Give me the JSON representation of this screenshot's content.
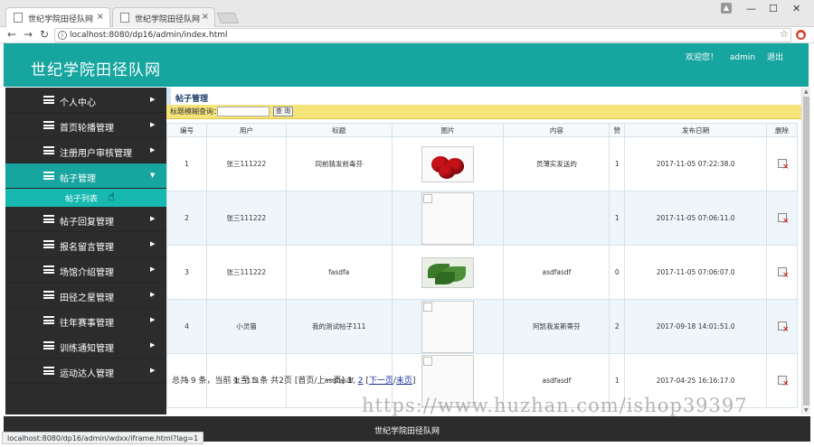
{
  "browser": {
    "tabs": [
      {
        "title": "世纪学院田径队网",
        "active": true
      },
      {
        "title": "世纪学院田径队网",
        "active": false
      }
    ],
    "url": "localhost:8080/dp16/admin/index.html",
    "status_url": "localhost:8080/dp16/admin/wdxx/iframe.html?lag=1"
  },
  "header": {
    "site_title": "世纪学院田径队网",
    "welcome": "欢迎您！",
    "username": "admin",
    "logout": "退出"
  },
  "sidebar": {
    "items": [
      {
        "label": "个人中心"
      },
      {
        "label": "首页轮播管理"
      },
      {
        "label": "注册用户审核管理"
      },
      {
        "label": "帖子管理",
        "open": true
      },
      {
        "label": "帖子回复管理"
      },
      {
        "label": "报名留言管理"
      },
      {
        "label": "场馆介绍管理"
      },
      {
        "label": "田径之星管理"
      },
      {
        "label": "往年赛事管理"
      },
      {
        "label": "训练通知管理"
      },
      {
        "label": "运动达人管理"
      }
    ],
    "sub_item": "帖子列表"
  },
  "main": {
    "breadcrumb": "帖子管理",
    "search": {
      "label": "标题模糊查询：",
      "button": "查 询",
      "value": ""
    },
    "table": {
      "headers": [
        "编号",
        "用户",
        "标题",
        "图片",
        "内容",
        "赞",
        "发布日期",
        "删除"
      ],
      "rows": [
        {
          "id": "1",
          "user": "张三111222",
          "title": "同前猜发前毒芬",
          "image": "tomato",
          "content": "员薄实发送的",
          "likes": "1",
          "date": "2017-11-05 07:22:38.0"
        },
        {
          "id": "2",
          "user": "张三111222",
          "title": "",
          "image": "broken",
          "content": "",
          "likes": "1",
          "date": "2017-11-05 07:06:11.0"
        },
        {
          "id": "3",
          "user": "张三111222",
          "title": "fasdfa",
          "image": "spinach",
          "content": "asdfasdf",
          "likes": "0",
          "date": "2017-11-05 07:06:07.0"
        },
        {
          "id": "4",
          "user": "小灵猫",
          "title": "我的测试帖子111",
          "image": "broken",
          "content": "阿凯我发斯蒂芬",
          "likes": "2",
          "date": "2017-09-18 14:01:51.0"
        },
        {
          "id": "5",
          "user": "张三111",
          "title": "asdfasdf",
          "image": "broken",
          "content": "asdfasdf",
          "likes": "1",
          "date": "2017-04-25 16:16:17.0"
        }
      ]
    },
    "pager": {
      "summary": "总共 9 条，当前 1 至 5 条 共2页",
      "first_prev": "[首页/上一页]",
      "page1": "1",
      "page2": "2",
      "next": "下一页",
      "last": "末页"
    }
  },
  "footer": {
    "text": "世纪学院田径队网"
  },
  "watermark": "https://www.huzhan.com/ishop39397",
  "colors": {
    "header": "#17a5a0",
    "sidebar": "#2c2c2c",
    "search_bar": "#f5e47a"
  }
}
